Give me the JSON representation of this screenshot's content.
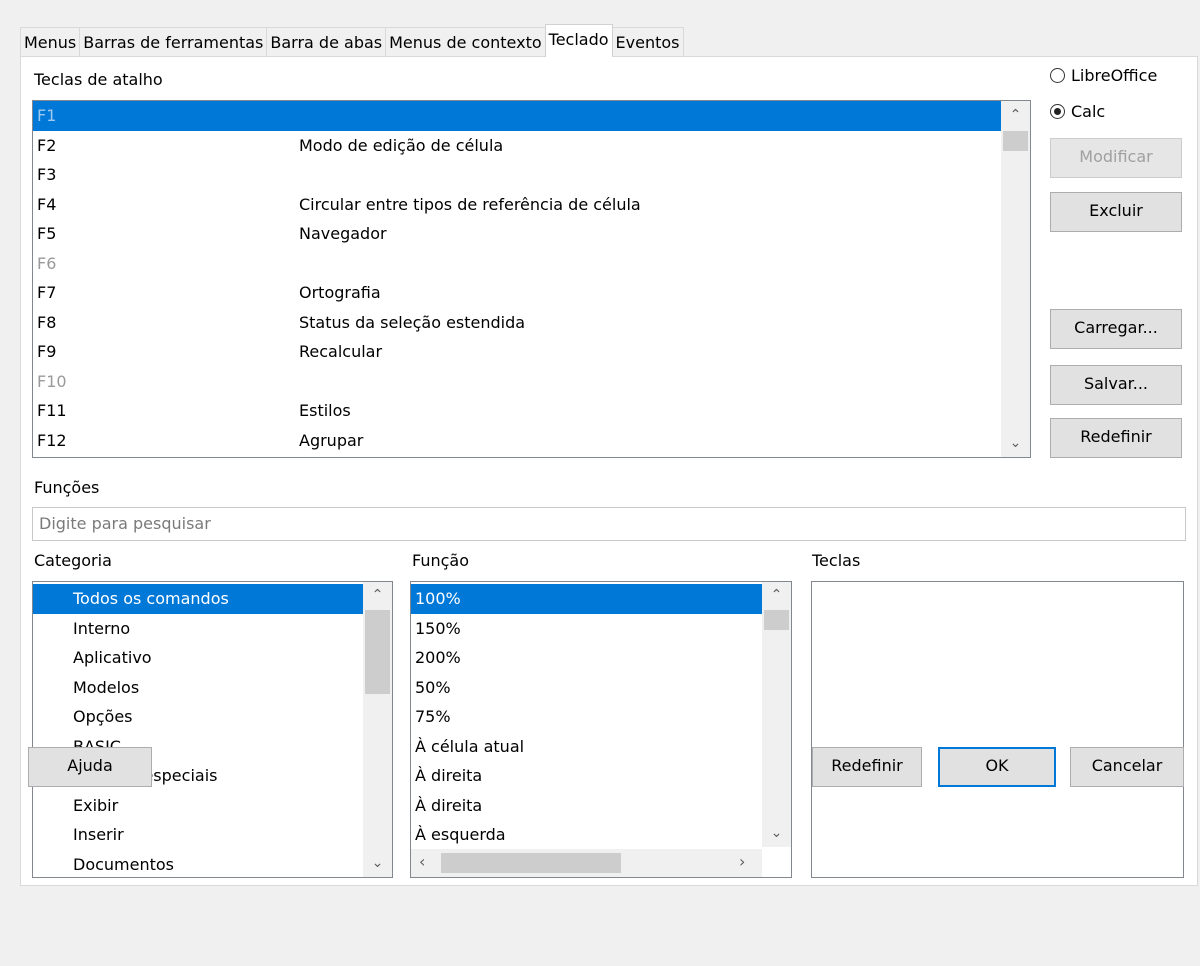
{
  "tabs": [
    {
      "label": "Menus",
      "active": false
    },
    {
      "label": "Barras de ferramentas",
      "active": false
    },
    {
      "label": "Barra de abas",
      "active": false
    },
    {
      "label": "Menus de contexto",
      "active": false
    },
    {
      "label": "Teclado",
      "active": true
    },
    {
      "label": "Eventos",
      "active": false
    }
  ],
  "shortcuts": {
    "label": "Teclas de atalho",
    "rows": [
      {
        "key": "F1",
        "function": "",
        "selected": true,
        "disabled": true
      },
      {
        "key": "F2",
        "function": "Modo de edição de célula"
      },
      {
        "key": "F3",
        "function": ""
      },
      {
        "key": "F4",
        "function": "Circular entre tipos de referência de célula"
      },
      {
        "key": "F5",
        "function": "Navegador"
      },
      {
        "key": "F6",
        "function": "",
        "disabled": true
      },
      {
        "key": "F7",
        "function": "Ortografia"
      },
      {
        "key": "F8",
        "function": "Status da seleção estendida"
      },
      {
        "key": "F9",
        "function": "Recalcular"
      },
      {
        "key": "F10",
        "function": "",
        "disabled": true
      },
      {
        "key": "F11",
        "function": "Estilos"
      },
      {
        "key": "F12",
        "function": "Agrupar"
      }
    ]
  },
  "scope": {
    "libreoffice_label": "LibreOffice",
    "calc_label": "Calc",
    "selected": "Calc"
  },
  "buttons": {
    "modify": "Modificar",
    "delete": "Excluir",
    "load": "Carregar...",
    "save": "Salvar...",
    "reset": "Redefinir"
  },
  "functions": {
    "label": "Funções",
    "search_placeholder": "Digite para pesquisar"
  },
  "category": {
    "label": "Categoria",
    "items": [
      "Todos os comandos",
      "Interno",
      "Aplicativo",
      "Modelos",
      "Opções",
      "BASIC",
      "Funções especiais",
      "Exibir",
      "Inserir",
      "Documentos"
    ],
    "selected_index": 0
  },
  "function_list": {
    "label": "Função",
    "items": [
      "100%",
      "150%",
      "200%",
      "50%",
      "75%",
      "À célula atual",
      "À direita",
      "À direita",
      "À esquerda"
    ],
    "selected_index": 0
  },
  "keys": {
    "label": "Teclas"
  },
  "footer": {
    "help": "Ajuda",
    "reset": "Redefinir",
    "ok": "OK",
    "cancel": "Cancelar"
  }
}
